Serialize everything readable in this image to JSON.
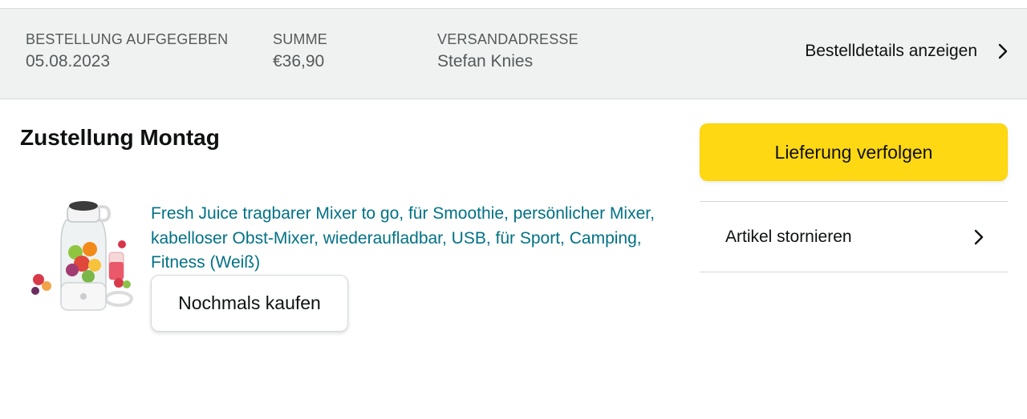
{
  "order_header": {
    "placed": {
      "label": "BESTELLUNG AUFGEGEBEN",
      "value": "05.08.2023"
    },
    "total": {
      "label": "SUMME",
      "value": "€36,90"
    },
    "ship_to": {
      "label": "VERSANDADRESSE",
      "value": "Stefan Knies"
    },
    "details_link": "Bestelldetails anzeigen"
  },
  "delivery": {
    "title": "Zustellung Montag"
  },
  "product": {
    "title": "Fresh Juice tragbarer Mixer to go, für Smoothie, persönlicher Mixer, kabelloser Obst-Mixer, wiederaufladbar, USB, für Sport, Camping, Fitness (Weiß)",
    "buy_again_label": "Nochmals kaufen"
  },
  "actions": {
    "track_label": "Lieferung verfolgen",
    "cancel_label": "Artikel stornieren"
  },
  "colors": {
    "header_bg": "#f0f2f2",
    "primary_button": "#ffd814",
    "link": "#007185"
  }
}
